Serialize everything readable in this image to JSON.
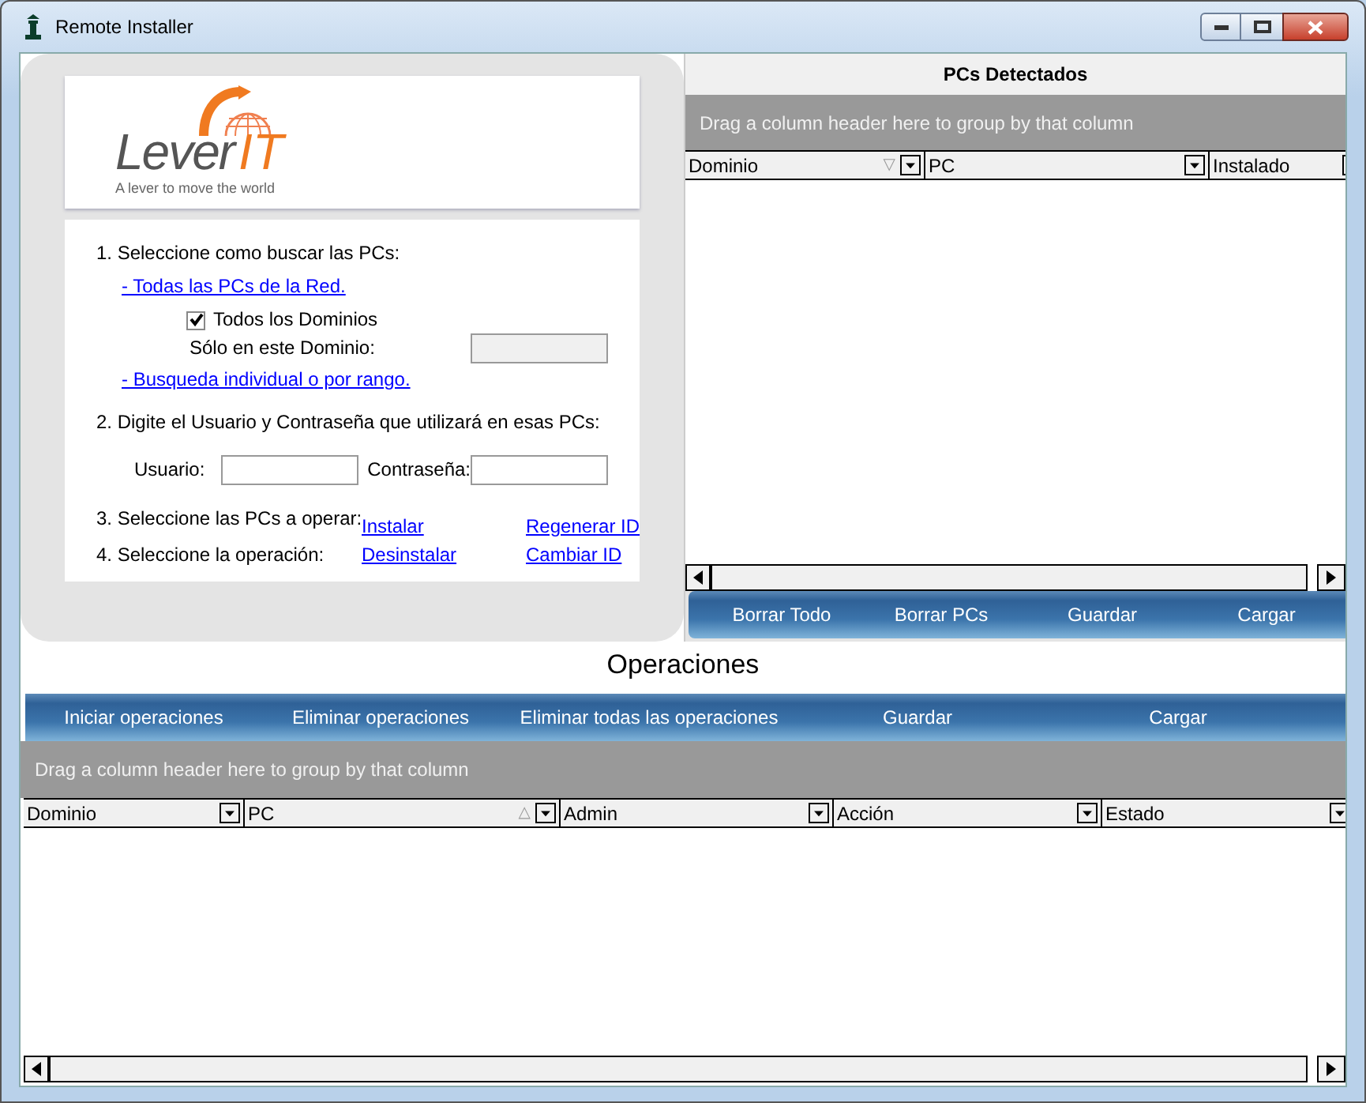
{
  "window": {
    "title": "Remote Installer"
  },
  "logo": {
    "brand_main": "Lever",
    "brand_accent": "IT",
    "tagline": "A lever to move the world"
  },
  "wizard": {
    "step1": "1. Seleccione como buscar las PCs:",
    "link_all": "- Todas las PCs de la Red.",
    "all_domains": {
      "label": "Todos los Dominios",
      "checked": true
    },
    "domain_label": "Sólo en este Dominio:",
    "domain_field": {
      "disabled": true
    },
    "link_individual": "- Busqueda individual o por rango.",
    "step2": "2. Digite el Usuario y  Contraseña que utilizará en esas PCs:",
    "user_label": "Usuario:",
    "password_label": "Contraseña:",
    "step3": "3. Seleccione las PCs a operar:",
    "step4": "4. Seleccione la operación:",
    "operations": [
      "Instalar",
      "Regenerar ID",
      "Desinstalar",
      "Cambiar ID"
    ]
  },
  "detected": {
    "title": "PCs Detectados",
    "group_hint": "Drag a column header here to group by that column",
    "columns": [
      {
        "label": "Dominio",
        "sort_mark": "▽"
      },
      {
        "label": "PC"
      },
      {
        "label": "Instalado"
      }
    ],
    "buttons": [
      "Borrar Todo",
      "Borrar PCs",
      "Guardar",
      "Cargar"
    ]
  },
  "operations": {
    "title": "Operaciones",
    "buttons": [
      "Iniciar operaciones",
      "Eliminar operaciones",
      "Eliminar todas las operaciones",
      "Guardar",
      "Cargar"
    ],
    "group_hint": "Drag a column header here to group by that column",
    "columns": [
      {
        "label": "Dominio"
      },
      {
        "label": "PC",
        "sort_mark": "△"
      },
      {
        "label": "Admin"
      },
      {
        "label": "Acción"
      },
      {
        "label": "Estado"
      }
    ]
  }
}
